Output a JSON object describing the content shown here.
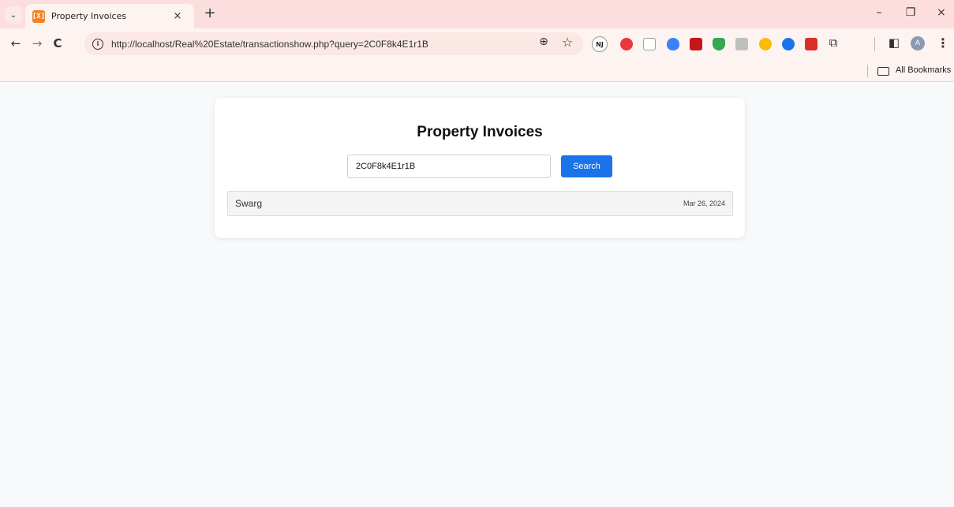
{
  "browser": {
    "tab_title": "Property Invoices",
    "favicon_glyph": "[X]",
    "url": "http://localhost/Real%20Estate/transactionshow.php?query=2C0F8k4E1r1B",
    "bookmarks_label": "All Bookmarks",
    "profile_initial": "A",
    "extension_badge": "NJ",
    "icons": {
      "tab_search": "⌄",
      "tab_close": "×",
      "new_tab": "+",
      "minimize": "–",
      "restore": "❐",
      "close": "×",
      "back": "←",
      "forward": "→",
      "reload": "C",
      "info": "i",
      "zoom": "⊕",
      "star": "☆",
      "extensions": "⧉",
      "sidepanel": "◧",
      "menu": "⋮"
    },
    "extension_colors": [
      "#e8383d",
      "#9aa0a6",
      "#3b82f6",
      "#c4161c",
      "#34a853",
      "#8d8d8d",
      "#fbbc04",
      "#1a73e8",
      "#d93025"
    ],
    "accent_color": "#fcdede"
  },
  "page": {
    "title": "Property Invoices",
    "search": {
      "value": "2C0F8k4E1r1B",
      "button_label": "Search",
      "button_color": "#1a73e8"
    },
    "results": [
      {
        "name": "Swarg",
        "date": "Mar 26, 2024"
      }
    ]
  }
}
